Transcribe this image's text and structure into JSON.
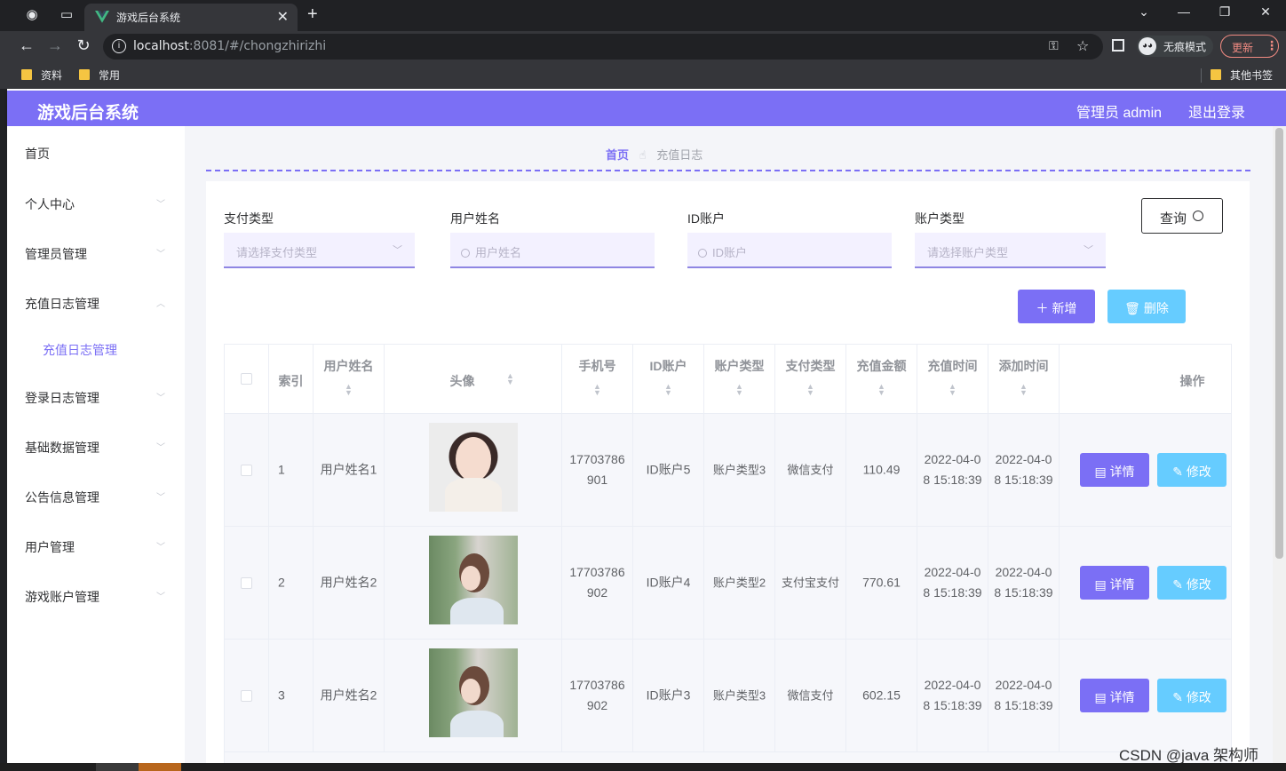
{
  "browser": {
    "tab_title": "游戏后台系统",
    "url_host": "localhost",
    "url_path": ":8081/#/chongzhirizhi",
    "incognito_label": "无痕模式",
    "update_label": "更新",
    "bookmarks": [
      "资料",
      "常用"
    ],
    "other_bookmarks": "其他书签"
  },
  "header": {
    "title": "游戏后台系统",
    "admin": "管理员 admin",
    "logout": "退出登录",
    "accent": "#7b6ff5"
  },
  "sidebar": {
    "items": [
      {
        "label": "首页"
      },
      {
        "label": "个人中心"
      },
      {
        "label": "管理员管理"
      },
      {
        "label": "充值日志管理"
      },
      {
        "label": "登录日志管理"
      },
      {
        "label": "基础数据管理"
      },
      {
        "label": "公告信息管理"
      },
      {
        "label": "用户管理"
      },
      {
        "label": "游戏账户管理"
      }
    ],
    "sub_item": "充值日志管理"
  },
  "breadcrumb": {
    "home": "首页",
    "current": "充值日志"
  },
  "filters": [
    {
      "label": "支付类型",
      "placeholder": "请选择支付类型"
    },
    {
      "label": "用户姓名",
      "placeholder": "用户姓名"
    },
    {
      "label": "ID账户",
      "placeholder": "ID账户"
    },
    {
      "label": "账户类型",
      "placeholder": "请选择账户类型"
    }
  ],
  "buttons": {
    "query": "查询",
    "add": "新增",
    "delete": "删除",
    "detail": "详情",
    "edit": "修改"
  },
  "table": {
    "headers": [
      "索引",
      "用户姓名",
      "头像",
      "手机号",
      "ID账户",
      "账户类型",
      "支付类型",
      "充值金额",
      "充值时间",
      "添加时间",
      "操作"
    ],
    "rows": [
      {
        "index": "1",
        "name": "用户姓名1",
        "phone": "17703786901",
        "account": "ID账户5",
        "account_type": "账户类型3",
        "pay_type": "微信支付",
        "amount": "110.49",
        "recharge_time": "2022-04-08 15:18:39",
        "add_time": "2022-04-08 15:18:39"
      },
      {
        "index": "2",
        "name": "用户姓名2",
        "phone": "17703786902",
        "account": "ID账户4",
        "account_type": "账户类型2",
        "pay_type": "支付宝支付",
        "amount": "770.61",
        "recharge_time": "2022-04-08 15:18:39",
        "add_time": "2022-04-08 15:18:39"
      },
      {
        "index": "3",
        "name": "用户姓名2",
        "phone": "17703786902",
        "account": "ID账户3",
        "account_type": "账户类型3",
        "pay_type": "微信支付",
        "amount": "602.15",
        "recharge_time": "2022-04-08 15:18:39",
        "add_time": "2022-04-08 15:18:39"
      }
    ]
  },
  "watermark": "CSDN @java 架构师"
}
